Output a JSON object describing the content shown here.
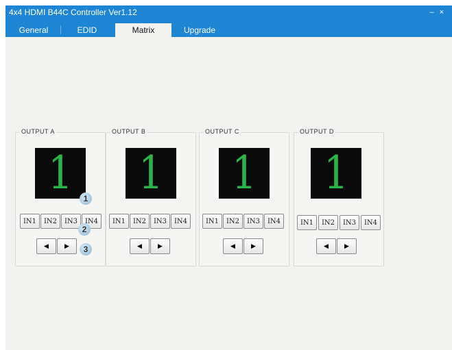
{
  "window": {
    "title": "4x4 HDMI B44C Controller Ver1.12",
    "minimize_glyph": "–",
    "close_glyph": "×"
  },
  "tabs": [
    {
      "label": "General",
      "active": false
    },
    {
      "label": "EDID",
      "active": false
    },
    {
      "label": "Matrix",
      "active": true
    },
    {
      "label": "Upgrade",
      "active": false
    }
  ],
  "outputs": [
    {
      "label": "OUTPUT A",
      "current_input": "1",
      "inputs": [
        "IN1",
        "IN2",
        "IN3",
        "IN4"
      ]
    },
    {
      "label": "OUTPUT B",
      "current_input": "1",
      "inputs": [
        "IN1",
        "IN2",
        "IN3",
        "IN4"
      ]
    },
    {
      "label": "OUTPUT C",
      "current_input": "1",
      "inputs": [
        "IN1",
        "IN2",
        "IN3",
        "IN4"
      ]
    },
    {
      "label": "OUTPUT D",
      "current_input": "1",
      "inputs": [
        "IN1",
        "IN2",
        "IN3",
        "IN4"
      ]
    }
  ],
  "arrows": {
    "prev": "◀",
    "next": "▶"
  },
  "callouts": [
    "1",
    "2",
    "3"
  ],
  "colors": {
    "titlebar": "#1e84d4",
    "digit": "#2bb34b",
    "screen": "#0a0a0a"
  }
}
